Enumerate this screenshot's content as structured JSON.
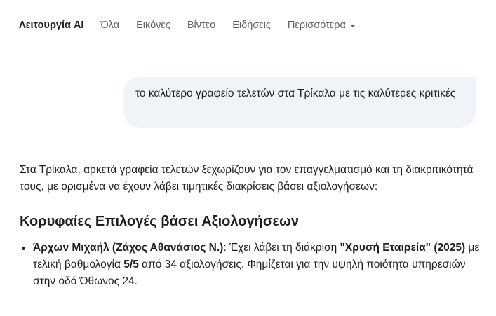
{
  "nav": {
    "tabs": [
      {
        "label": "Λειτουργία AI"
      },
      {
        "label": "Όλα"
      },
      {
        "label": "Εικόνες"
      },
      {
        "label": "Βίντεο"
      },
      {
        "label": "Ειδήσεις"
      },
      {
        "label": "Περισσότερα"
      }
    ]
  },
  "query": {
    "text": "το καλύτερο γραφείο τελετών στα Τρίκαλα με τις καλύτερες κριτικές"
  },
  "answer": {
    "intro": "Στα Τρίκαλα, αρκετά γραφεία τελετών ξεχωρίζουν για τον επαγγελματισμό και τη διακριτικότητά τους, με ορισμένα να έχουν λάβει τιμητικές διακρίσεις βάσει αξιολογήσεων:",
    "section_title": "Κορυφαίες Επιλογές βάσει Αξιολογήσεων",
    "items": [
      {
        "name": "Άρχων Μιχαήλ (Ζάχος Αθανάσιος Ν.)",
        "t1": ": Έχει λάβει τη διάκριση ",
        "award": "\"Χρυσή Εταιρεία\" (2025)",
        "t2": " με τελική βαθμολογία ",
        "score": "5/5",
        "t3": " από 34 αξιολογήσεις. Φημίζεται για την υψηλή ποιότητα υπηρεσιών στην οδό Όθωνος 24."
      }
    ]
  }
}
